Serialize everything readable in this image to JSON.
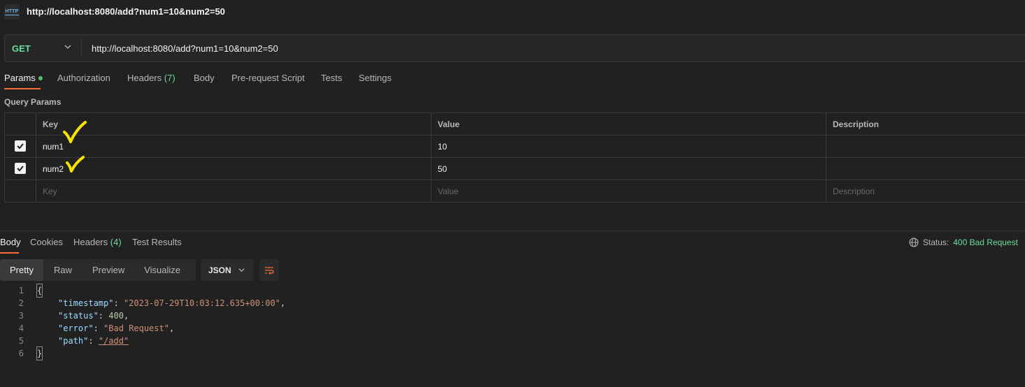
{
  "window": {
    "title": "http://localhost:8080/add?num1=10&num2=50",
    "icon_text": "HTTP"
  },
  "request": {
    "method": "GET",
    "url": "http://localhost:8080/add?num1=10&num2=50"
  },
  "request_tabs": [
    {
      "label": "Params",
      "active": true,
      "dot": true
    },
    {
      "label": "Authorization"
    },
    {
      "label": "Headers",
      "count": "(7)"
    },
    {
      "label": "Body"
    },
    {
      "label": "Pre-request Script"
    },
    {
      "label": "Tests"
    },
    {
      "label": "Settings"
    }
  ],
  "query_params": {
    "title": "Query Params",
    "headers": [
      "Key",
      "Value",
      "Description"
    ],
    "rows": [
      {
        "checked": true,
        "key": "num1",
        "value": "10",
        "description": ""
      },
      {
        "checked": true,
        "key": "num2",
        "value": "50",
        "description": ""
      }
    ],
    "placeholder": {
      "key": "Key",
      "value": "Value",
      "description": "Description"
    }
  },
  "response_tabs": [
    {
      "label": "Body",
      "active": true
    },
    {
      "label": "Cookies"
    },
    {
      "label": "Headers",
      "count": "(4)"
    },
    {
      "label": "Test Results"
    }
  ],
  "status": {
    "label": "Status:",
    "value": "400 Bad Request",
    "color": "#6bdd9a"
  },
  "view_modes": [
    "Pretty",
    "Raw",
    "Preview",
    "Visualize"
  ],
  "format": "JSON",
  "response_body": {
    "line_numbers": [
      "1",
      "2",
      "3",
      "4",
      "5",
      "6"
    ],
    "open_brace": "{",
    "close_brace": "}",
    "fields": [
      {
        "key": "\"timestamp\"",
        "value": "\"2023-07-29T10:03:12.635+00:00\"",
        "type": "string"
      },
      {
        "key": "\"status\"",
        "value": "400",
        "type": "number"
      },
      {
        "key": "\"error\"",
        "value": "\"Bad Request\"",
        "type": "string"
      },
      {
        "key": "\"path\"",
        "value": "\"/add\"",
        "type": "string"
      }
    ]
  },
  "colors": {
    "accent": "#ff6c37",
    "method": "#6bdd9a",
    "annotation": "#f5e400"
  }
}
